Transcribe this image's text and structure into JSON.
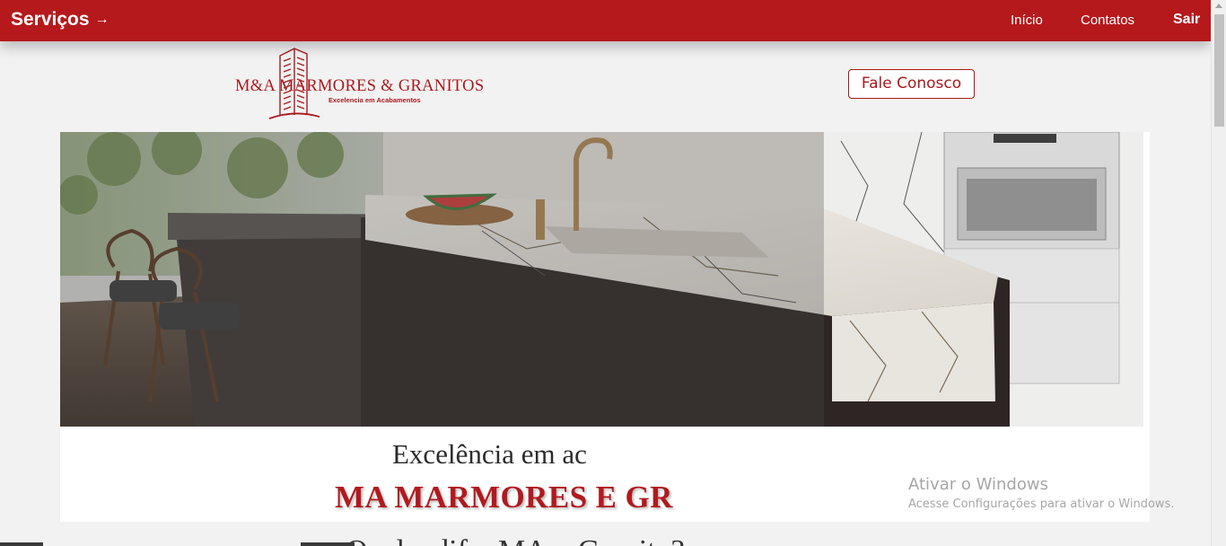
{
  "nav": {
    "brand": "Serviços",
    "brand_arrow": "→",
    "links": [
      "Início",
      "Contatos"
    ],
    "logout": "Sair",
    "background_color": "#b5191c"
  },
  "logo": {
    "title": "M&A MARMORES & GRANITOS",
    "subtitle": "Excelencia em Acabamentos",
    "color": "#a8191d",
    "icon": "building-icon"
  },
  "contact_button": {
    "label": "Fale Conosco"
  },
  "hero": {
    "image": "kitchen-marble-island-photo",
    "caption_line1": "Excelência em ac",
    "caption_line2": "MA MARMORES E GR"
  },
  "next_section": {
    "heading_partial": "Qual a dif... MA... Granito?"
  },
  "windows_watermark": {
    "title": "Ativar o Windows",
    "subtitle": "Acesse Configurações para ativar o Windows."
  }
}
